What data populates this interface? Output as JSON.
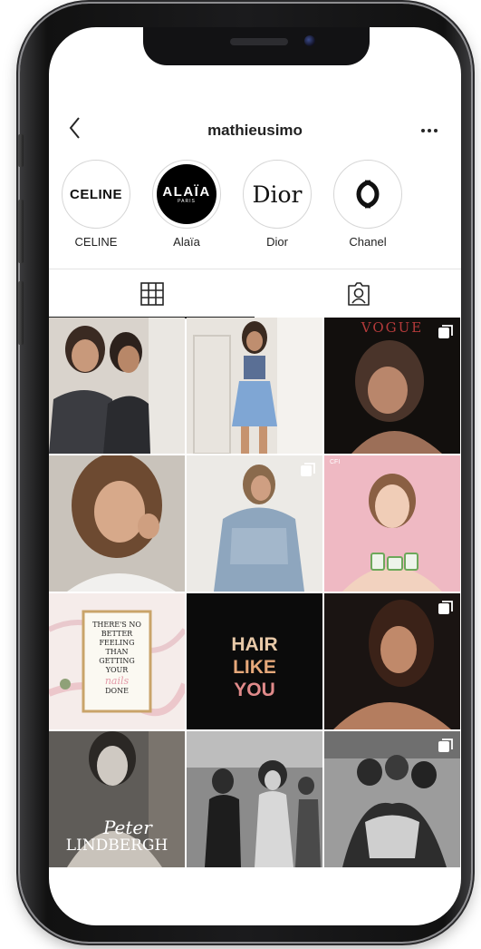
{
  "profile": {
    "username": "mathieusimo"
  },
  "highlights": [
    {
      "label": "CELINE",
      "cover_text": "CELINE"
    },
    {
      "label": "Alaïa",
      "cover_text": "ALAÏA",
      "cover_sub": "PARIS"
    },
    {
      "label": "Dior",
      "cover_text": "Dior"
    },
    {
      "label": "Chanel"
    }
  ],
  "tabs": [
    {
      "name": "posts-grid",
      "icon": "grid-icon",
      "active": true
    },
    {
      "name": "tagged",
      "icon": "tagged-person-icon",
      "active": false
    }
  ],
  "posts": {
    "vogue_masthead": "VOGUE",
    "cfi_label": "CFI",
    "quote_lines": [
      "THERE'S NO",
      "BETTER",
      "FEELING",
      "THAN",
      "GETTING",
      "YOUR"
    ],
    "quote_script": "nails",
    "quote_end": "DONE",
    "hair_lines": [
      "HAIR",
      "LIKE",
      "YOU"
    ],
    "peter_script": "Peter",
    "peter_name": "LINDBERGH"
  },
  "colors": {
    "accent": "#262626",
    "divider": "#e4e4e4"
  }
}
